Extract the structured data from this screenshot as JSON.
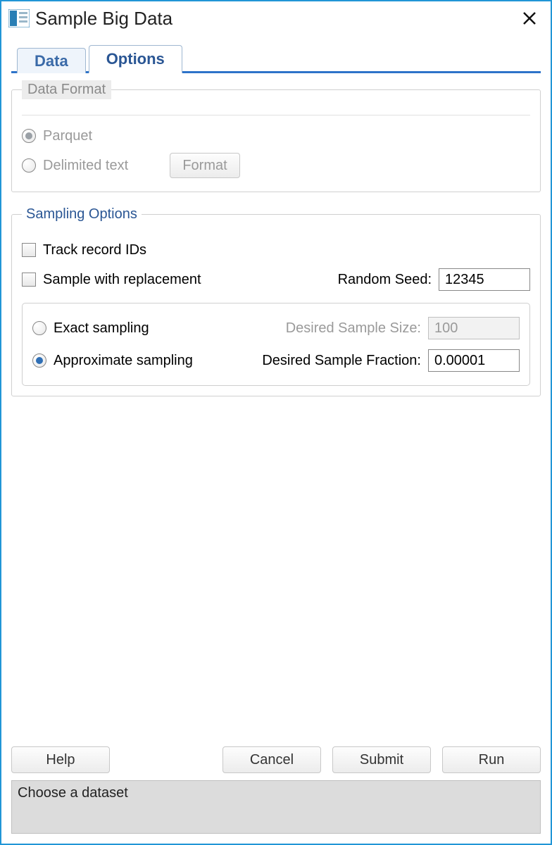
{
  "window": {
    "title": "Sample Big Data"
  },
  "tabs": {
    "data": "Data",
    "options": "Options"
  },
  "data_format": {
    "legend": "Data Format",
    "parquet": "Parquet",
    "delimited": "Delimited text",
    "format_btn": "Format"
  },
  "sampling": {
    "legend": "Sampling Options",
    "track_ids": "Track record IDs",
    "with_replacement": "Sample with replacement",
    "random_seed_label": "Random Seed:",
    "random_seed_value": "12345",
    "exact": "Exact sampling",
    "approx": "Approximate sampling",
    "desired_size_label": "Desired Sample Size:",
    "desired_size_value": "100",
    "desired_fraction_label": "Desired Sample Fraction:",
    "desired_fraction_value": "0.00001"
  },
  "buttons": {
    "help": "Help",
    "cancel": "Cancel",
    "submit": "Submit",
    "run": "Run"
  },
  "status": "Choose a dataset"
}
